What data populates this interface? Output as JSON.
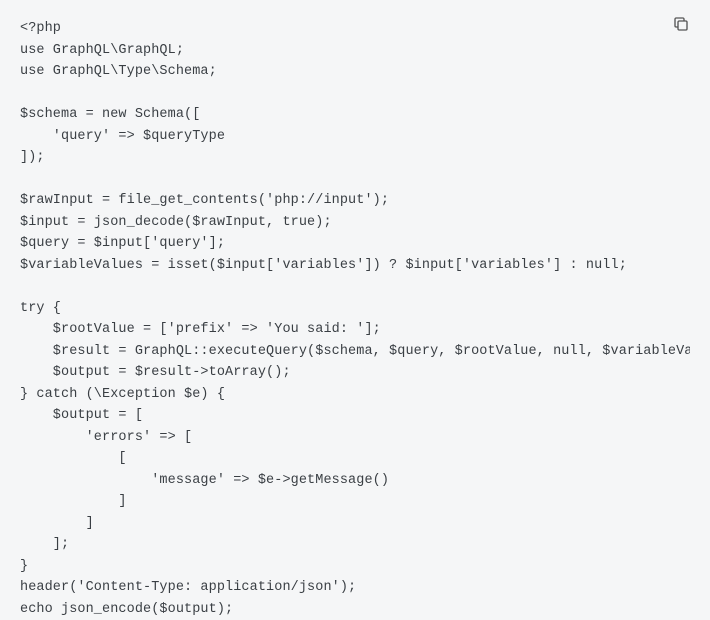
{
  "code": {
    "lines": [
      "<?php",
      "use GraphQL\\GraphQL;",
      "use GraphQL\\Type\\Schema;",
      "",
      "$schema = new Schema([",
      "    'query' => $queryType",
      "]);",
      "",
      "$rawInput = file_get_contents('php://input');",
      "$input = json_decode($rawInput, true);",
      "$query = $input['query'];",
      "$variableValues = isset($input['variables']) ? $input['variables'] : null;",
      "",
      "try {",
      "    $rootValue = ['prefix' => 'You said: '];",
      "    $result = GraphQL::executeQuery($schema, $query, $rootValue, null, $variableVal",
      "    $output = $result->toArray();",
      "} catch (\\Exception $e) {",
      "    $output = [",
      "        'errors' => [",
      "            [",
      "                'message' => $e->getMessage()",
      "            ]",
      "        ]",
      "    ];",
      "}",
      "header('Content-Type: application/json');",
      "echo json_encode($output);"
    ]
  },
  "icons": {
    "copy": "copy"
  }
}
